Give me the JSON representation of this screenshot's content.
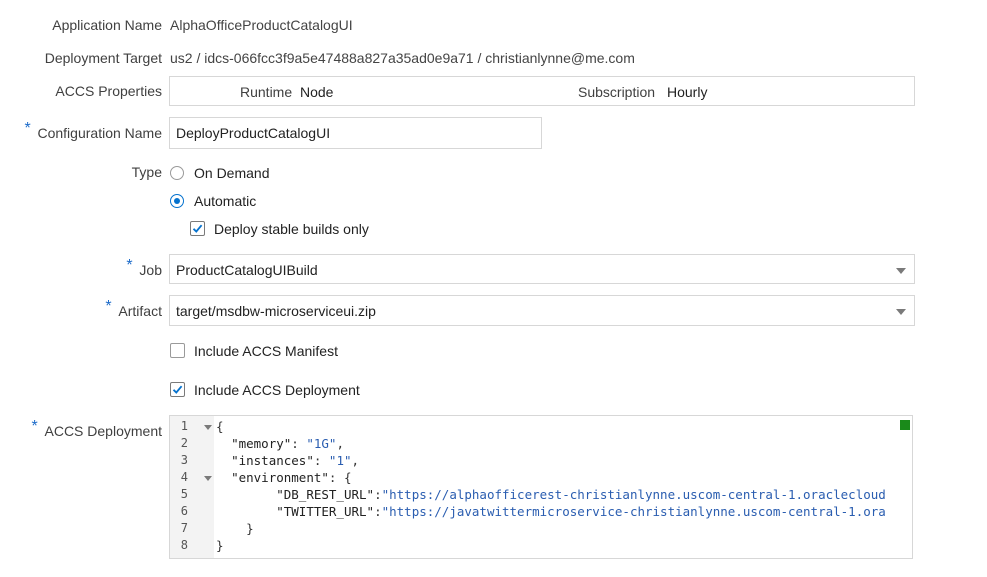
{
  "app_name": {
    "label": "Application Name",
    "value": "AlphaOfficeProductCatalogUI"
  },
  "deployment_target": {
    "label": "Deployment Target",
    "value": "us2 / idcs-066fcc3f9a5e47488a827a35ad0e9a71 / christianlynne@me.com"
  },
  "accs_properties": {
    "label": "ACCS Properties",
    "runtime_label": "Runtime",
    "runtime_value": "Node",
    "subscription_label": "Subscription",
    "subscription_value": "Hourly"
  },
  "configuration_name": {
    "label": "Configuration Name",
    "value": "DeployProductCatalogUI",
    "required": "*"
  },
  "type": {
    "label": "Type",
    "options": [
      {
        "label": "On Demand",
        "selected": false
      },
      {
        "label": "Automatic",
        "selected": true
      }
    ],
    "stable_builds": {
      "label": "Deploy stable builds only",
      "checked": true
    }
  },
  "job": {
    "label": "Job",
    "value": "ProductCatalogUIBuild",
    "required": "*"
  },
  "artifact": {
    "label": "Artifact",
    "value": "target/msdbw-microserviceui.zip",
    "required": "*"
  },
  "include_manifest": {
    "label": "Include ACCS Manifest",
    "checked": false
  },
  "include_deployment": {
    "label": "Include ACCS Deployment",
    "checked": true
  },
  "accs_deployment": {
    "label": "ACCS Deployment",
    "required": "*",
    "status_color": "#1a8a1a",
    "lines": [
      {
        "num": "1",
        "text": "{"
      },
      {
        "num": "2",
        "text": "  \"memory\": \"1G\","
      },
      {
        "num": "3",
        "text": "  \"instances\": \"1\","
      },
      {
        "num": "4",
        "text": "  \"environment\": {"
      },
      {
        "num": "5",
        "text": "        \"DB_REST_URL\":\"https://alphaofficerest-christianlynne.uscom-central-1.oraclecloud"
      },
      {
        "num": "6",
        "text": "        \"TWITTER_URL\":\"https://javatwittermicroservice-christianlynne.uscom-central-1.ora"
      },
      {
        "num": "7",
        "text": "    }"
      },
      {
        "num": "8",
        "text": "}"
      }
    ]
  },
  "colors": {
    "accent": "#0572ce",
    "required": "#1b6ac9",
    "json_string": "#2a5db0"
  }
}
